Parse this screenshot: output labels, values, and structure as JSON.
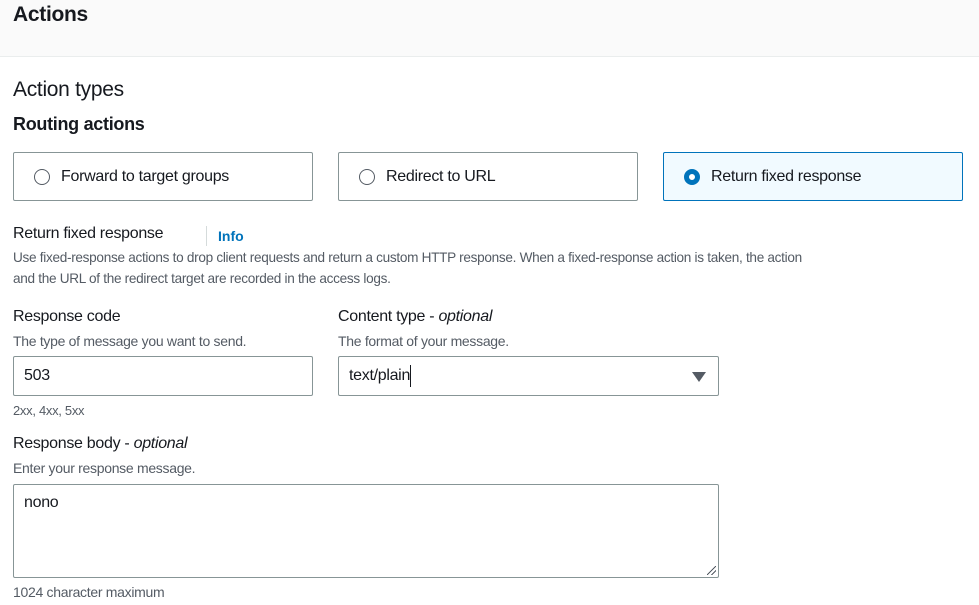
{
  "header": {
    "title": "Actions"
  },
  "section": {
    "title": "Action types",
    "subtitle": "Routing actions"
  },
  "routing_options": [
    {
      "label": "Forward to target groups",
      "selected": false
    },
    {
      "label": "Redirect to URL",
      "selected": false
    },
    {
      "label": "Return fixed response",
      "selected": true
    }
  ],
  "fixed_response": {
    "title": "Return fixed response",
    "info_link": "Info",
    "description_line1": "Use fixed-response actions to drop client requests and return a custom HTTP response. When a fixed-response action is taken, the action",
    "description_line2": "and the URL of the redirect target are recorded in the access logs."
  },
  "response_code": {
    "label": "Response code",
    "description": "The type of message you want to send.",
    "value": "503",
    "hint": "2xx, 4xx, 5xx"
  },
  "content_type": {
    "label": "Content type - ",
    "optional": "optional",
    "description": "The format of your message.",
    "value": "text/plain"
  },
  "response_body": {
    "label": "Response body - ",
    "optional": "optional",
    "description": "Enter your response message.",
    "value": "nono",
    "hint": "1024 character maximum"
  },
  "colors": {
    "accent": "#0073bb",
    "selected_bg": "#f1faff"
  }
}
